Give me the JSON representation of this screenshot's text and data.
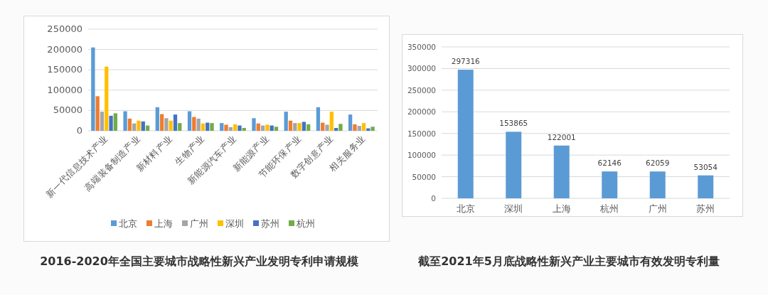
{
  "charts": [
    {
      "caption": "2016-2020年全国主要城市战略性新兴产业发明专利申请规模",
      "chart_data": {
        "type": "bar",
        "categories": [
          "新一代信息技术产业",
          "高端装备制造产业",
          "新材料产业",
          "生物产业",
          "新能源汽车产业",
          "新能源产业",
          "节能环保产业",
          "数字创意产业",
          "相关服务业"
        ],
        "ylim": [
          0,
          250000
        ],
        "yticks": [
          0,
          50000,
          100000,
          150000,
          200000,
          250000
        ],
        "grid": true,
        "legend": true,
        "series": [
          {
            "name": "北京",
            "color": "#5b9bd5",
            "values": [
              205000,
              48000,
              58000,
              48000,
              19000,
              31000,
              47000,
              58000,
              40000
            ]
          },
          {
            "name": "上海",
            "color": "#ed7d31",
            "values": [
              85000,
              30000,
              41000,
              34000,
              15000,
              18000,
              25000,
              20000,
              16000
            ]
          },
          {
            "name": "广州",
            "color": "#a5a5a5",
            "values": [
              47000,
              18000,
              31000,
              30000,
              9000,
              13000,
              19000,
              15000,
              12000
            ]
          },
          {
            "name": "深圳",
            "color": "#ffc000",
            "values": [
              158000,
              25000,
              25000,
              18000,
              16000,
              15000,
              19000,
              47000,
              19000
            ]
          },
          {
            "name": "苏州",
            "color": "#4472c4",
            "values": [
              37000,
              23000,
              40000,
              20000,
              13000,
              13000,
              22000,
              7000,
              6000
            ]
          },
          {
            "name": "杭州",
            "color": "#70ad47",
            "values": [
              43000,
              13000,
              19000,
              19000,
              7000,
              10000,
              16000,
              17000,
              10000
            ]
          }
        ]
      }
    },
    {
      "caption": "截至2021年5月底战略性新兴产业主要城市有效发明专利量",
      "chart_data": {
        "type": "bar",
        "categories": [
          "北京",
          "深圳",
          "上海",
          "杭州",
          "广州",
          "苏州"
        ],
        "ylim": [
          0,
          350000
        ],
        "yticks": [
          0,
          50000,
          100000,
          150000,
          200000,
          250000,
          300000,
          350000
        ],
        "data_labels": true,
        "grid": true,
        "values": [
          297316,
          153865,
          122001,
          62146,
          62059,
          53054
        ]
      }
    }
  ]
}
